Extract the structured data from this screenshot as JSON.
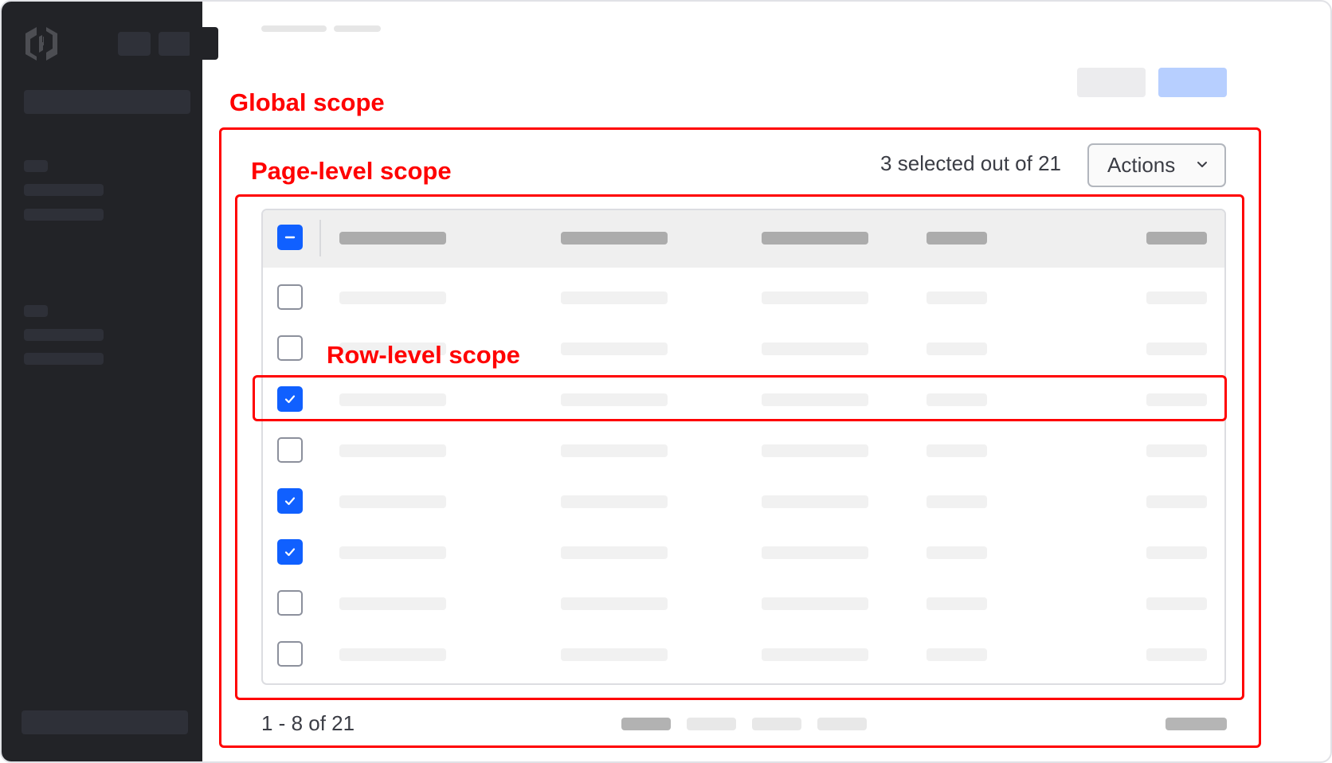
{
  "sidebar": {
    "logo_icon": "hashicorp-logo-icon",
    "top_buttons": [
      "placeholder",
      "placeholder"
    ],
    "sections": [
      {
        "items": [
          "placeholder",
          "placeholder"
        ]
      },
      {
        "items": [
          "placeholder",
          "placeholder"
        ]
      }
    ]
  },
  "annotations": {
    "global_scope": "Global scope",
    "page_level_scope": "Page-level scope",
    "row_level_scope": "Row-level scope",
    "annotation_color": "#ff0000"
  },
  "toolbar": {
    "selection_status": "3 selected out of 21",
    "actions_label": "Actions",
    "actions_icon": "chevron-down-icon"
  },
  "table": {
    "header_checkbox_state": "indeterminate",
    "column_count": 5,
    "rows": [
      {
        "checked": false
      },
      {
        "checked": false
      },
      {
        "checked": true
      },
      {
        "checked": false
      },
      {
        "checked": true
      },
      {
        "checked": true
      },
      {
        "checked": false
      },
      {
        "checked": false
      }
    ]
  },
  "pagination": {
    "range_text": "1 - 8 of 21",
    "current_page": 1,
    "visible_pages": 4
  },
  "colors": {
    "sidebar_bg": "#222327",
    "accent_blue": "#1060ff",
    "primary_button_placeholder": "#b7cfff"
  }
}
